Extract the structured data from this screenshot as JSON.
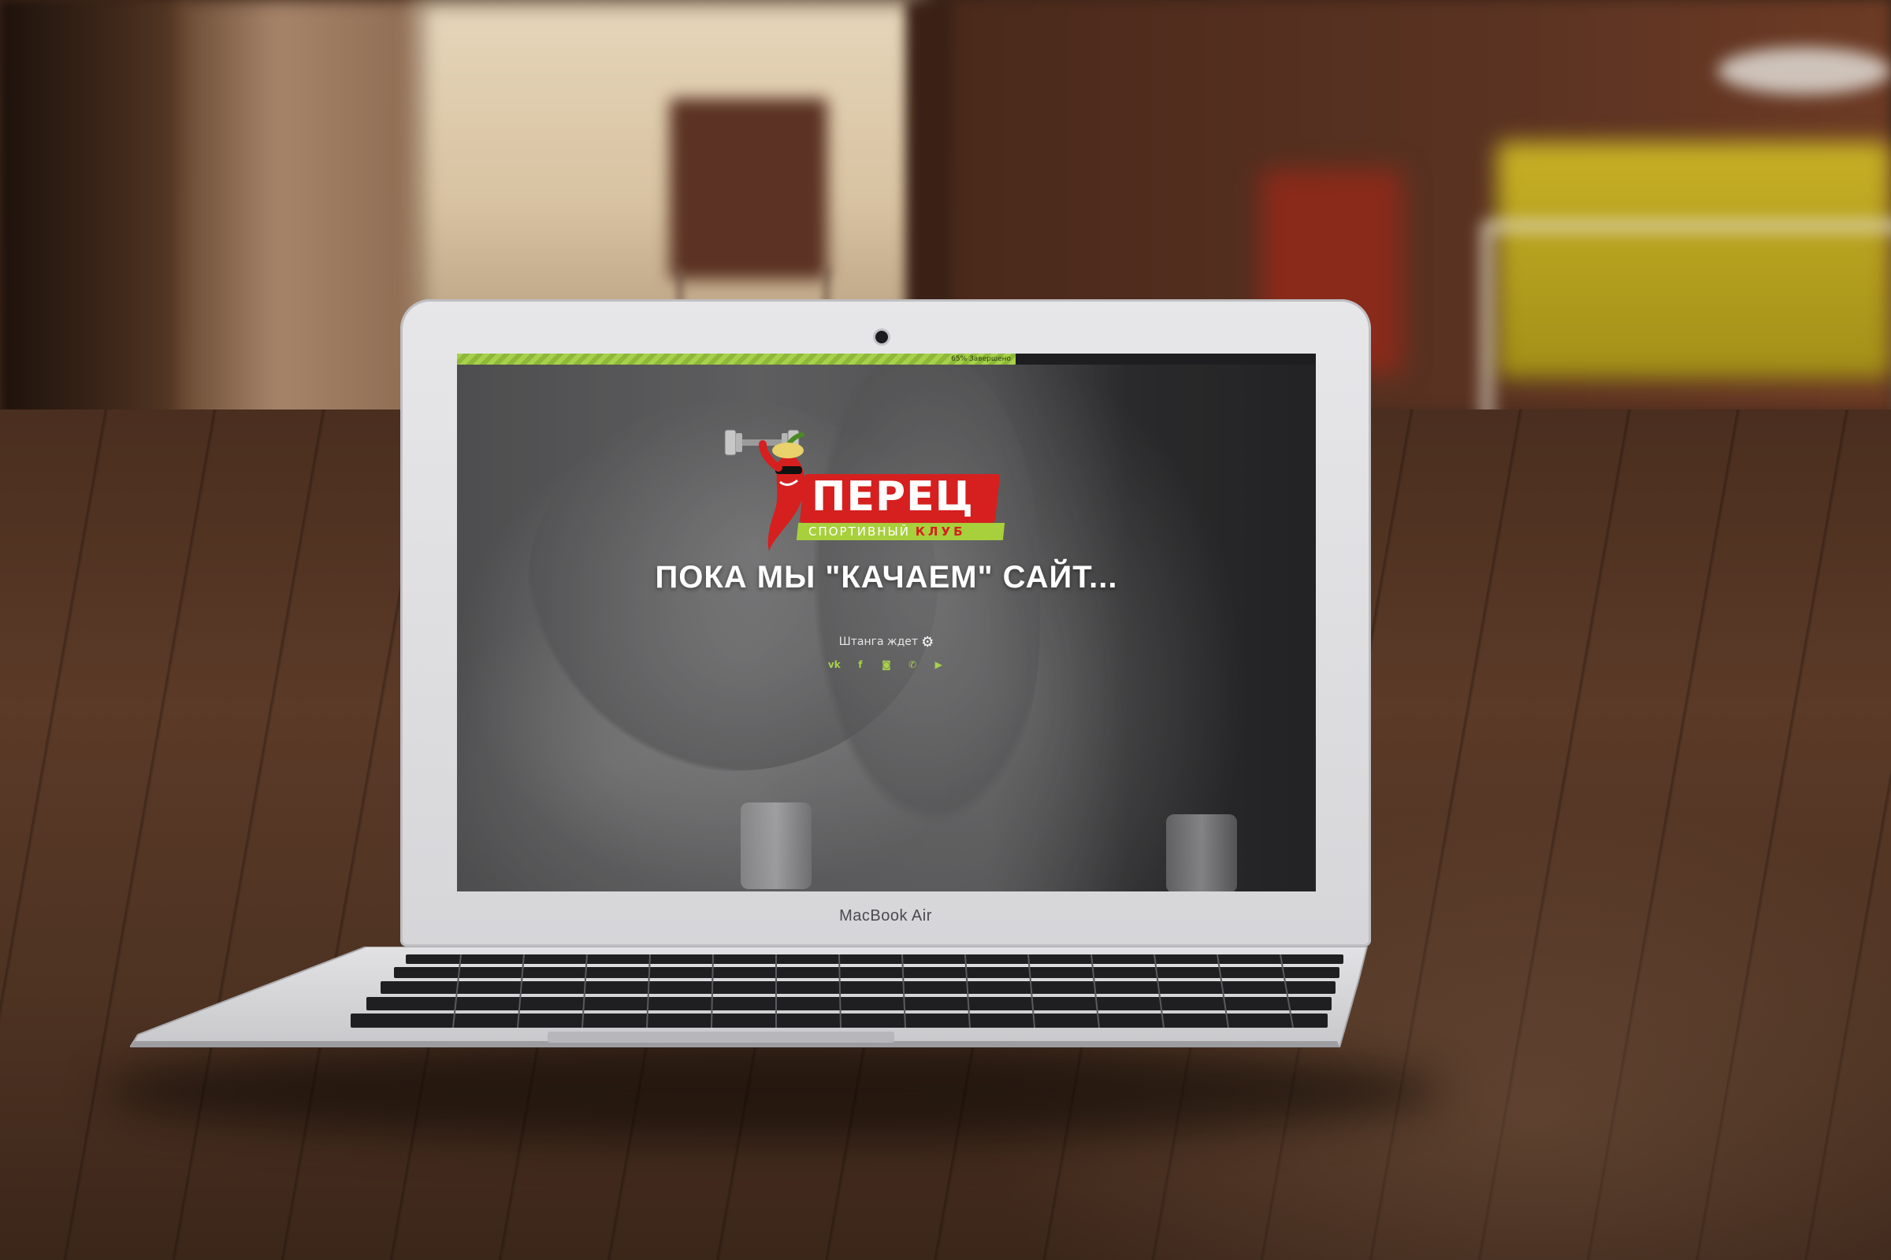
{
  "screen": {
    "progress": {
      "percent": 65,
      "label": "65% Завершено"
    },
    "logo": {
      "title": "ПЕРЕЦ",
      "subtitle_main": "СПОРТИВНЫЙ",
      "subtitle_accent": "КЛУБ"
    },
    "headline": "ПОКА МЫ \"КАЧАЕМ\" САЙТ...",
    "subline": "Штанга ждет",
    "socials": [
      {
        "icon": "vk-icon",
        "glyph": "vk"
      },
      {
        "icon": "facebook-icon",
        "glyph": "f"
      },
      {
        "icon": "instagram-icon",
        "glyph": "◙"
      },
      {
        "icon": "phone-icon",
        "glyph": "✆"
      },
      {
        "icon": "youtube-icon",
        "glyph": "▶"
      }
    ],
    "colors": {
      "accent_green": "#a7d14b",
      "brand_red": "#d5201f"
    }
  },
  "device": {
    "brand": "MacBook Air"
  }
}
